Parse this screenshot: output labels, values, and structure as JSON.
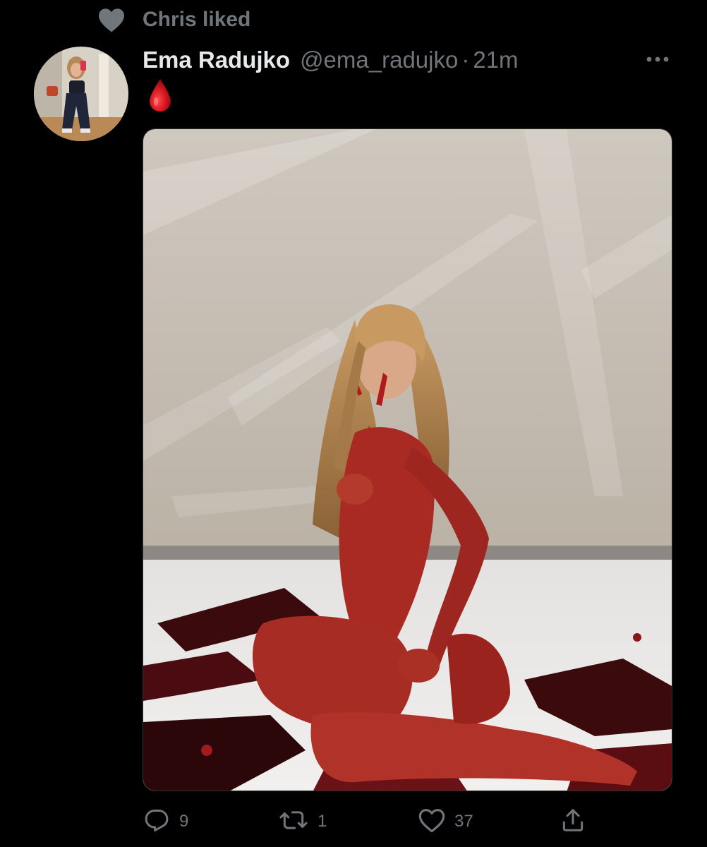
{
  "social_context": {
    "text": "Chris liked",
    "icon": "heart-filled-icon"
  },
  "tweet": {
    "display_name": "Ema Radujko",
    "handle": "@ema_radujko",
    "separator": "·",
    "time": "21m",
    "body_emoji": "drop-of-blood",
    "media_description_icon": "photo"
  },
  "actions": {
    "reply_count": "9",
    "retweet_count": "1",
    "like_count": "37"
  },
  "colors": {
    "background": "#000000",
    "primary_text": "#e7e9ea",
    "secondary_text": "#71767b",
    "blood": "#d0141c"
  }
}
